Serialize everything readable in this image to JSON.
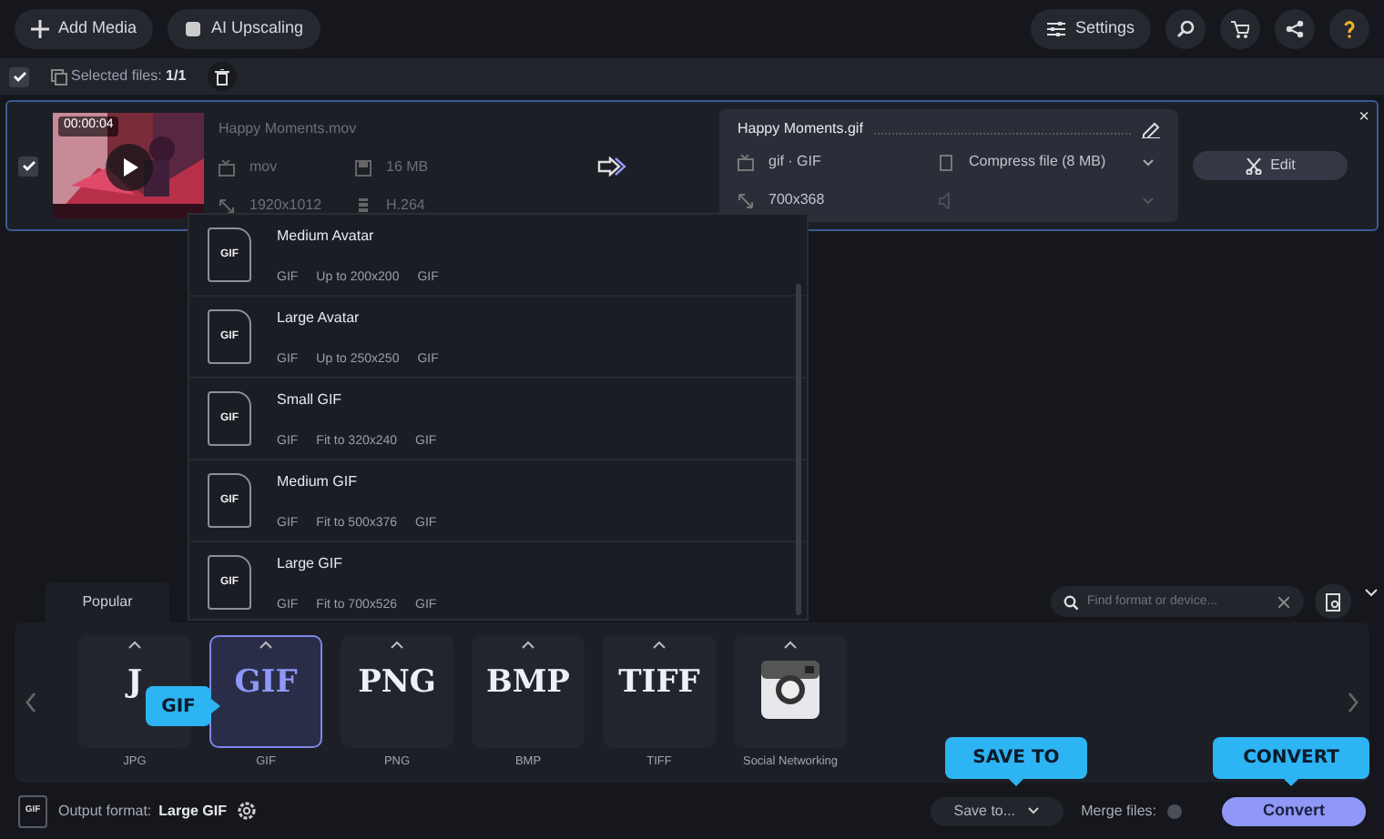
{
  "toolbar": {
    "left_buttons": [
      {
        "label": "Add Media"
      },
      {
        "label": "AI Upscaling"
      }
    ],
    "settings_label": "Settings"
  },
  "selection_bar": {
    "checked": true,
    "label": "Selected files:",
    "count": "1/1"
  },
  "file": {
    "checked": true,
    "duration": "00:00:04",
    "name": "Happy Moments.mov",
    "format": "mov",
    "size": "16 MB",
    "resolution": "1920x1012",
    "codec": "H.264",
    "output": {
      "name": "Happy Moments.gif",
      "format": "gif · GIF",
      "compression": "Compress file (8 MB)",
      "resolution": "700x368"
    },
    "edit_label": "Edit",
    "close": "×"
  },
  "preset_menu": [
    {
      "title": "Medium Avatar",
      "badge": "GIF",
      "format": "GIF",
      "size": "Up to 200x200",
      "codec": "GIF"
    },
    {
      "title": "Large Avatar",
      "badge": "GIF",
      "format": "GIF",
      "size": "Up to 250x250",
      "codec": "GIF"
    },
    {
      "title": "Small GIF",
      "badge": "GIF",
      "format": "GIF",
      "size": "Fit to 320x240",
      "codec": "GIF"
    },
    {
      "title": "Medium GIF",
      "badge": "GIF",
      "format": "GIF",
      "size": "Fit to 500x376",
      "codec": "GIF"
    },
    {
      "title": "Large GIF",
      "badge": "GIF",
      "format": "GIF",
      "size": "Fit to 700x526",
      "codec": "GIF"
    }
  ],
  "format_tabs": [
    {
      "label": "Popular",
      "selected": true
    }
  ],
  "format_search": {
    "placeholder": "Find format or device..."
  },
  "formats": [
    {
      "kind": "text",
      "logo": "J",
      "label": "JPG",
      "selected": false
    },
    {
      "kind": "text",
      "logo": "GIF",
      "label": "GIF",
      "selected": true
    },
    {
      "kind": "text",
      "logo": "PNG",
      "label": "PNG",
      "selected": false
    },
    {
      "kind": "text",
      "logo": "BMP",
      "label": "BMP",
      "selected": false
    },
    {
      "kind": "text",
      "logo": "TIFF",
      "label": "TIFF",
      "selected": false
    },
    {
      "kind": "camera",
      "label": "Social Networking",
      "selected": false
    }
  ],
  "footer": {
    "badge": "GIF",
    "output_label": "Output format:",
    "output_value": "Large GIF",
    "save_label": "Save to...",
    "merge_label": "Merge files:",
    "merge_on": false,
    "convert_label": "Convert"
  },
  "callouts": [
    {
      "text": "GIF"
    },
    {
      "text": "SAVE TO"
    },
    {
      "text": "CONVERT"
    }
  ]
}
